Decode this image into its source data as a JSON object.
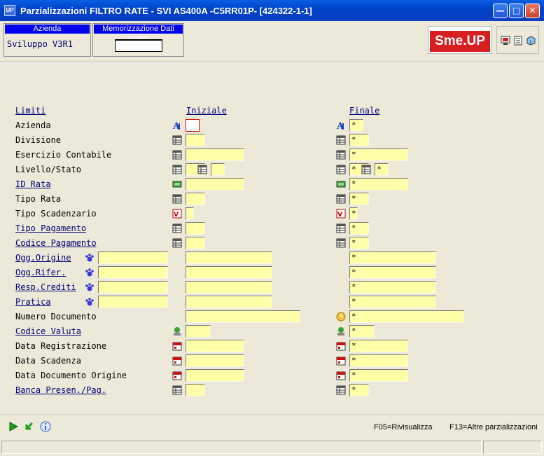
{
  "window": {
    "title": "Parzializzazioni  FILTRO RATE - SVI AS400A -C5RR01P- [424322-1-1]",
    "app_icon": "UP",
    "minimize_icon": "minimize-icon",
    "maximize_icon": "maximize-icon",
    "close_icon": "close-icon"
  },
  "header": {
    "azienda_label": "Azienda",
    "azienda_value": "Sviluppo V3R1",
    "memorizzazione_label": "Memorizzazione Dati Video",
    "memorizzazione_value": "",
    "logo": "Sme.UP",
    "brand_color": "#d81f1f"
  },
  "columns": {
    "limiti": "Limiti",
    "iniziale": "Iniziale",
    "finale": "Finale"
  },
  "rows": [
    {
      "label": "Azienda",
      "link": false,
      "iniziale": "",
      "finale": "*",
      "icon": "font-a-icon"
    },
    {
      "label": "Divisione",
      "link": false,
      "iniziale": "",
      "finale": "*",
      "icon": "table-icon"
    },
    {
      "label": "Esercizio Contabile",
      "link": false,
      "iniziale": "",
      "finale": "*",
      "icon": "table-icon"
    },
    {
      "label": "Livello/Stato",
      "link": false,
      "iniziale": "",
      "iniziale2": "",
      "finale": "*",
      "finale2": "*",
      "icon": "table-icon"
    },
    {
      "label": "ID Rata",
      "link": true,
      "iniziale": "",
      "finale": "*",
      "icon": "money-icon"
    },
    {
      "label": "Tipo Rata",
      "link": false,
      "iniziale": "",
      "finale": "*",
      "icon": "table-icon"
    },
    {
      "label": "Tipo Scadenzario",
      "link": false,
      "iniziale": "",
      "finale": "*",
      "icon": "v2-icon"
    },
    {
      "label": "Tipo Pagamento",
      "link": true,
      "iniziale": "",
      "finale": "*",
      "icon": "table-icon"
    },
    {
      "label": "Codice Pagamento",
      "link": true,
      "iniziale": "",
      "finale": "*",
      "icon": "table-icon"
    },
    {
      "label": "Ogg.Origine",
      "link": true,
      "obj": "",
      "iniziale": "",
      "finale": "*",
      "icon": "paw-icon"
    },
    {
      "label": "Ogg.Rifer.",
      "link": true,
      "obj": "",
      "iniziale": "",
      "finale": "*",
      "icon": "paw-icon"
    },
    {
      "label": "Resp.Crediti",
      "link": true,
      "obj": "",
      "iniziale": "",
      "finale": "*",
      "icon": "paw-icon"
    },
    {
      "label": "Pratica",
      "link": true,
      "obj": "",
      "iniziale": "",
      "finale": "*",
      "icon": "paw-icon"
    },
    {
      "label": "Numero Documento",
      "link": false,
      "iniziale": "",
      "finale": "*",
      "icon": "clock-icon"
    },
    {
      "label": "Codice Valuta",
      "link": true,
      "iniziale": "",
      "finale": "*",
      "icon": "currency-icon"
    },
    {
      "label": "Data Registrazione",
      "link": false,
      "iniziale": "",
      "finale": "*",
      "icon": "calendar-icon"
    },
    {
      "label": "Data Scadenza",
      "link": false,
      "iniziale": "",
      "finale": "*",
      "icon": "calendar-icon"
    },
    {
      "label": "Data Documento Origine",
      "link": false,
      "iniziale": "",
      "finale": "*",
      "icon": "calendar-icon"
    },
    {
      "label": "Banca Presen./Pag.",
      "link": true,
      "iniziale": "",
      "finale": "*",
      "icon": "table-icon"
    }
  ],
  "footer": {
    "f05": "F05=Rivisualizza",
    "f13": "F13=Altre parzializzazioni",
    "icons": [
      "play-icon",
      "refresh-icon",
      "info-icon"
    ]
  }
}
